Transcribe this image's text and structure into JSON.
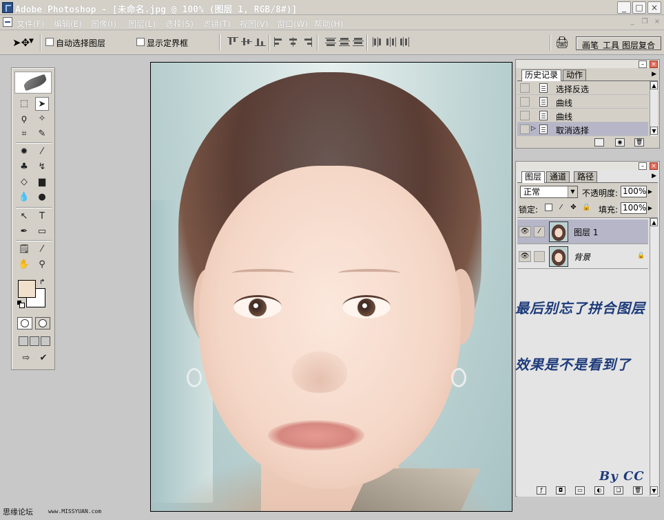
{
  "window": {
    "title": "Adobe Photoshop - [未命名.jpg @ 100% (图层 1, RGB/8#)]",
    "controls": {
      "minimize": "_",
      "maximize": "□",
      "close": "×"
    }
  },
  "menu": {
    "items": [
      "文件(F)",
      "编辑(E)",
      "图像(I)",
      "图层(L)",
      "选择(S)",
      "滤镜(T)",
      "视图(V)",
      "窗口(W)",
      "帮助(H)"
    ]
  },
  "options": {
    "auto_select_label": "自动选择图层",
    "show_bounds_label": "显示定界框",
    "palette_well": [
      "画笔",
      "工具",
      "图层复合"
    ]
  },
  "toolbox": {
    "foreground_color": "#f0e0cc",
    "background_color": "#ffffff"
  },
  "history_panel": {
    "tabs": [
      "历史记录",
      "动作"
    ],
    "items": [
      {
        "label": "选择反选",
        "selected": false
      },
      {
        "label": "曲线",
        "selected": false
      },
      {
        "label": "曲线",
        "selected": false
      },
      {
        "label": "取消选择",
        "selected": true
      }
    ]
  },
  "layers_panel": {
    "tabs": [
      "图层",
      "通道",
      "路径"
    ],
    "blend_mode": "正常",
    "opacity_label": "不透明度:",
    "opacity_value": "100%",
    "lock_label": "锁定:",
    "fill_label": "填充:",
    "fill_value": "100%",
    "layers": [
      {
        "name": "图层 1",
        "selected": true
      },
      {
        "name": "背景",
        "selected": false
      }
    ]
  },
  "annotations": {
    "line1": "最后别忘了拼合图层",
    "line2": "效果是不是看到了",
    "signature": "By  CC"
  },
  "watermark": {
    "site": "思缘论坛",
    "url": "www.MISSYUAN.com"
  }
}
